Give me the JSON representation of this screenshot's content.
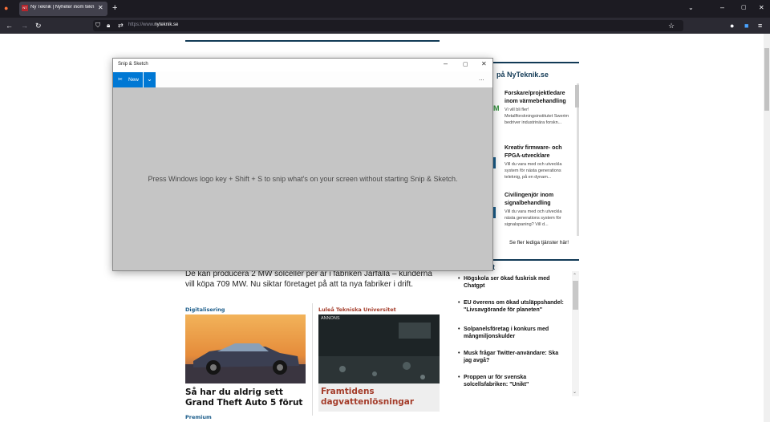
{
  "browser": {
    "tab_title": "Ny Teknik | Nyheter inom tekn",
    "favicon_text": "NT",
    "url_prefix": "https://www.",
    "url_domain": "nyteknik.se"
  },
  "article": {
    "lead_text": "De kan producera 2 MW solceller per år i fabriken Järfälla – kunderna vill köpa 709 MW. Nu siktar företaget på att ta nya fabriker i drift.",
    "cards": [
      {
        "kicker": "Digitalisering",
        "title": "Så har du aldrig sett Grand Theft Auto 5 förut"
      },
      {
        "kicker": "Luleå Tekniska Universitet",
        "badge": "ANNONS",
        "title": "Framtidens dagvattenlösningar"
      }
    ],
    "bottom_kicker": "Premium"
  },
  "sidebar": {
    "jobs_title": "på NyTeknik.se",
    "jobs": [
      {
        "title": "Forskare/projektledare inom värmebehandling",
        "desc": "Vi vill bli fler! Metallforskningsinstitutet Swerim bedriver industrinära forskn..."
      },
      {
        "title": "Kreativ firmware- och FPGA-utvecklare",
        "desc": "Vill du vara med och utveckla system för nästa generations teleknig, på en dynam..."
      },
      {
        "title": "Civilingenjör inom signalbehandling",
        "desc": "Vill du vara med och utveckla nästa generations system för signalspaning? Vill d..."
      }
    ],
    "jobs_more": "Se fler lediga tjänster här!",
    "news_title": "t",
    "news": [
      "Högskola ser ökad fuskrisk med Chatgpt",
      "EU överens om ökad utsläppshandel: \"Livsavgörande för planeten\"",
      "Solpanelsföretag i konkurs med mångmiljonskulder",
      "Musk frågar Twitter-användare: Ska jag avgå?",
      "Proppen ur för svenska solcellsfabriken: \"Unikt\""
    ]
  },
  "snip": {
    "title": "Snip & Sketch",
    "new_label": "New",
    "more": "...",
    "hint": "Press Windows logo key + Shift + S to snip what's on your screen without starting Snip & Sketch."
  },
  "colors": {
    "accent": "#0078d4",
    "brand": "#123a56",
    "kicker_blue": "#1a5c8a",
    "kicker_red": "#a43c2a"
  }
}
